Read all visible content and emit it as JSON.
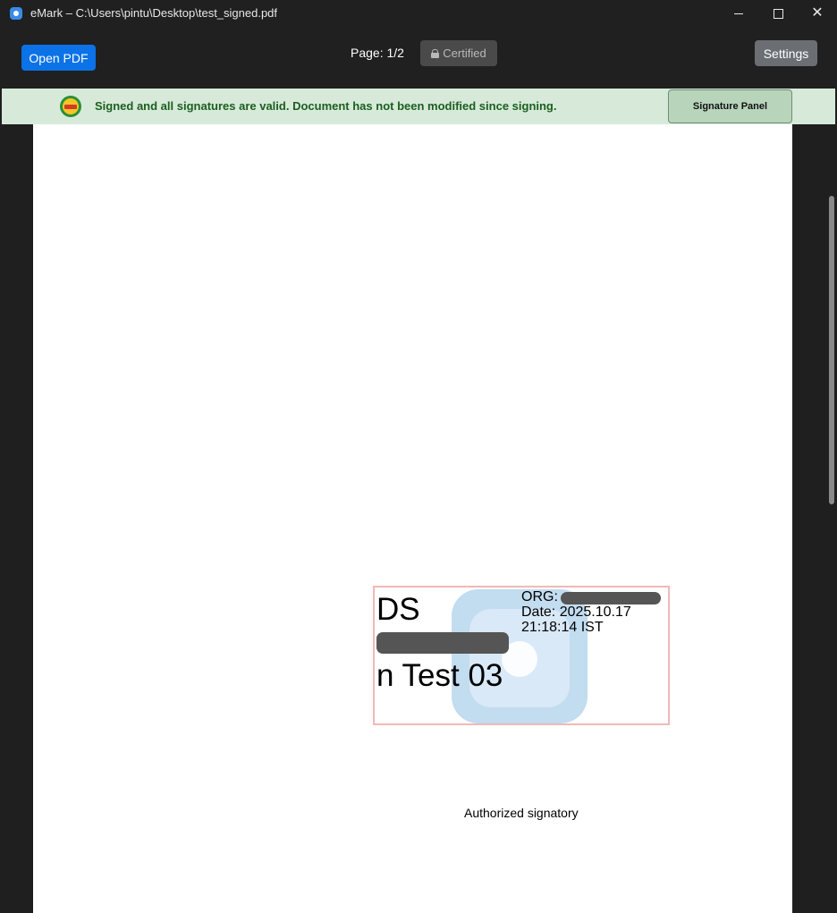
{
  "window": {
    "title": "eMark – C:\\Users\\pintu\\Desktop\\test_signed.pdf",
    "app_icon": "emark-app-icon"
  },
  "toolbar": {
    "open_label": "Open PDF",
    "page_indicator": "Page: 1/2",
    "certified_label": "Certified",
    "settings_label": "Settings"
  },
  "status": {
    "message": "Signed and all signatures are valid. Document has not been modified since signing.",
    "signature_panel_label": "Signature Panel",
    "color": "#1b5e20",
    "background": "#d7ead9"
  },
  "signature": {
    "name_line1": "DS",
    "name_line3": "n Test 03",
    "org_label": "ORG:",
    "date_line": "Date: 2025.10.17",
    "time_line": "21:18:14 IST"
  },
  "caption": "Authorized signatory",
  "colors": {
    "accent_button": "#0b72e7",
    "settings_button": "#6b6f74",
    "signature_border": "#f2b8b8"
  }
}
